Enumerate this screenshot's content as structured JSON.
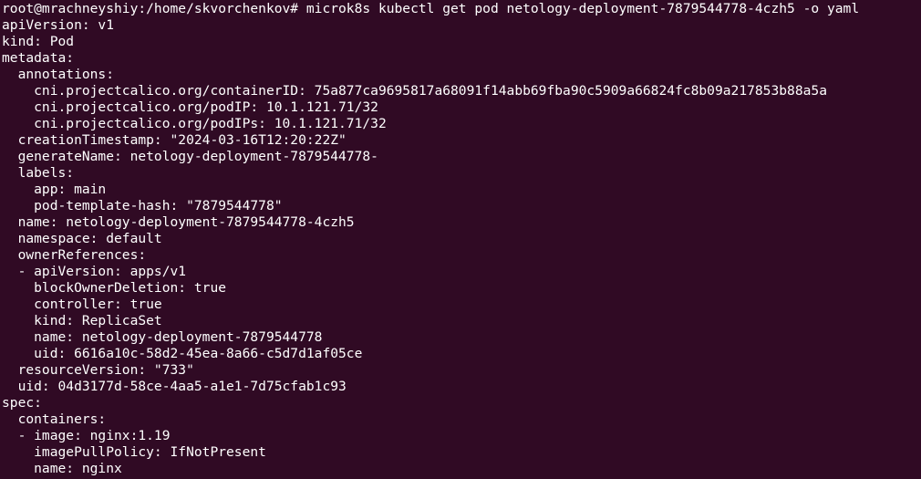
{
  "terminal": {
    "background": "#300a24",
    "foreground": "#ffffff",
    "lines": [
      "root@mrachneyshiy:/home/skvorchenkov# microk8s kubectl get pod netology-deployment-7879544778-4czh5 -o yaml",
      "apiVersion: v1",
      "kind: Pod",
      "metadata:",
      "  annotations:",
      "    cni.projectcalico.org/containerID: 75a877ca9695817a68091f14abb69fba90c5909a66824fc8b09a217853b88a5a",
      "    cni.projectcalico.org/podIP: 10.1.121.71/32",
      "    cni.projectcalico.org/podIPs: 10.1.121.71/32",
      "  creationTimestamp: \"2024-03-16T12:20:22Z\"",
      "  generateName: netology-deployment-7879544778-",
      "  labels:",
      "    app: main",
      "    pod-template-hash: \"7879544778\"",
      "  name: netology-deployment-7879544778-4czh5",
      "  namespace: default",
      "  ownerReferences:",
      "  - apiVersion: apps/v1",
      "    blockOwnerDeletion: true",
      "    controller: true",
      "    kind: ReplicaSet",
      "    name: netology-deployment-7879544778",
      "    uid: 6616a10c-58d2-45ea-8a66-c5d7d1af05ce",
      "  resourceVersion: \"733\"",
      "  uid: 04d3177d-58ce-4aa5-a1e1-7d75cfab1c93",
      "spec:",
      "  containers:",
      "  - image: nginx:1.19",
      "    imagePullPolicy: IfNotPresent",
      "    name: nginx"
    ]
  }
}
